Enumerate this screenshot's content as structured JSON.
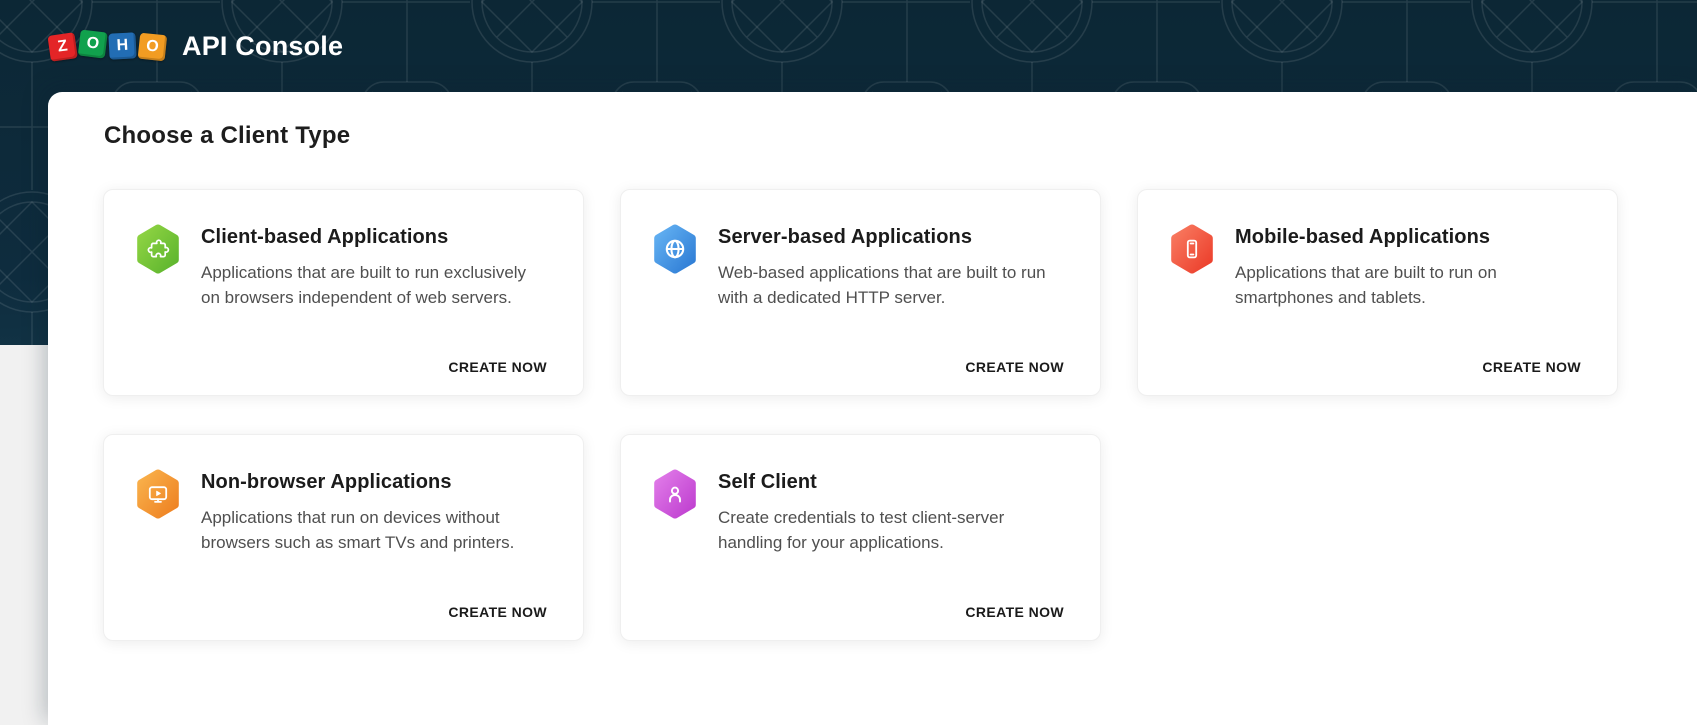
{
  "header": {
    "logo_tiles": [
      {
        "letter": "Z",
        "color": "#e42527"
      },
      {
        "letter": "O",
        "color": "#11a14d"
      },
      {
        "letter": "H",
        "color": "#226db4"
      },
      {
        "letter": "O",
        "color": "#f29c22"
      }
    ],
    "app_title": "API Console"
  },
  "main": {
    "heading": "Choose a Client Type",
    "cards": [
      {
        "id": "client-based",
        "title": "Client-based Applications",
        "description": "Applications that are built to run exclusively on browsers independent of web servers.",
        "action_label": "CREATE NOW",
        "icon": "puzzle-icon",
        "icon_color_start": "#90d443",
        "icon_color_end": "#5db52e"
      },
      {
        "id": "server-based",
        "title": "Server-based Applications",
        "description": "Web-based applications that are built to run with a dedicated HTTP server.",
        "action_label": "CREATE NOW",
        "icon": "globe-icon",
        "icon_color_start": "#63b1f2",
        "icon_color_end": "#2e7cd5"
      },
      {
        "id": "mobile-based",
        "title": "Mobile-based Applications",
        "description": "Applications that are built to run on smartphones and tablets.",
        "action_label": "CREATE NOW",
        "icon": "smartphone-icon",
        "icon_color_start": "#f87a60",
        "icon_color_end": "#ec3e2b"
      },
      {
        "id": "non-browser",
        "title": "Non-browser Applications",
        "description": "Applications that run on devices without browsers such as smart TVs and printers.",
        "action_label": "CREATE NOW",
        "icon": "tv-icon",
        "icon_color_start": "#f9b14b",
        "icon_color_end": "#ee8122"
      },
      {
        "id": "self-client",
        "title": "Self Client",
        "description": "Create credentials to test client-server handling for your applications.",
        "action_label": "CREATE NOW",
        "icon": "user-icon",
        "icon_color_start": "#e07ae8",
        "icon_color_end": "#bf3fd0"
      }
    ]
  },
  "colors": {
    "hero_bg": "#0d2a3b",
    "panel_bg": "#ffffff",
    "page_bg": "#f1f1f1",
    "heading_text": "#1d1d1d",
    "card_title": "#1b1b1b",
    "card_desc": "#4f4f4f",
    "action_text": "#1a1a1a"
  }
}
